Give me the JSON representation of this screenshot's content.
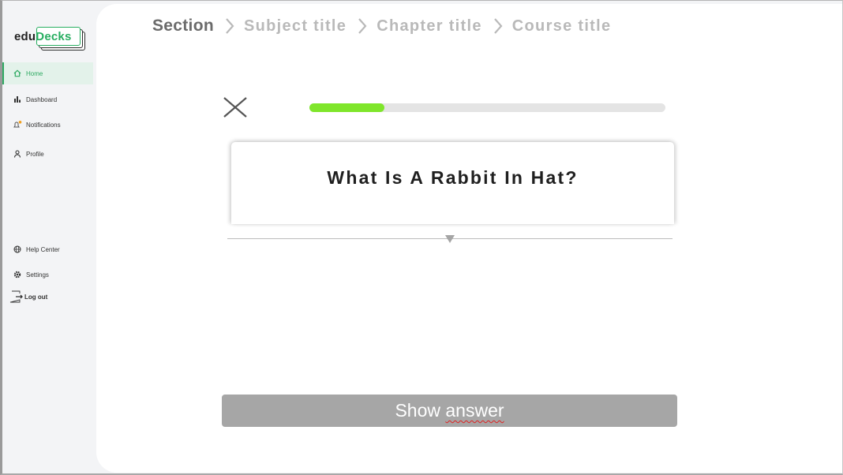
{
  "logo": {
    "part1": "edu",
    "part2": "Decks"
  },
  "sidebar": {
    "items": [
      {
        "label": "Home",
        "icon": "home-icon",
        "active": true
      },
      {
        "label": "Dashboard",
        "icon": "bar-chart-icon"
      },
      {
        "label": "Notifications",
        "icon": "bell-icon"
      },
      {
        "label": "Profile",
        "icon": "user-icon"
      },
      {
        "label": "Help Center",
        "icon": "globe-icon"
      },
      {
        "label": "Settings",
        "icon": "gear-icon"
      },
      {
        "label": "Log out",
        "icon": "logout-icon"
      }
    ]
  },
  "breadcrumb": [
    "Section",
    "Subject title",
    "Chapter title",
    "Course title"
  ],
  "progress": {
    "fraction": 0.21
  },
  "card": {
    "question": "What Is A Rabbit In Hat?"
  },
  "actions": {
    "show_answer_prefix": "Show ",
    "show_answer_word": "answer"
  },
  "colors": {
    "accent": "#2eaa62",
    "progress": "#7fe62b",
    "button": "#a6a6a6"
  }
}
